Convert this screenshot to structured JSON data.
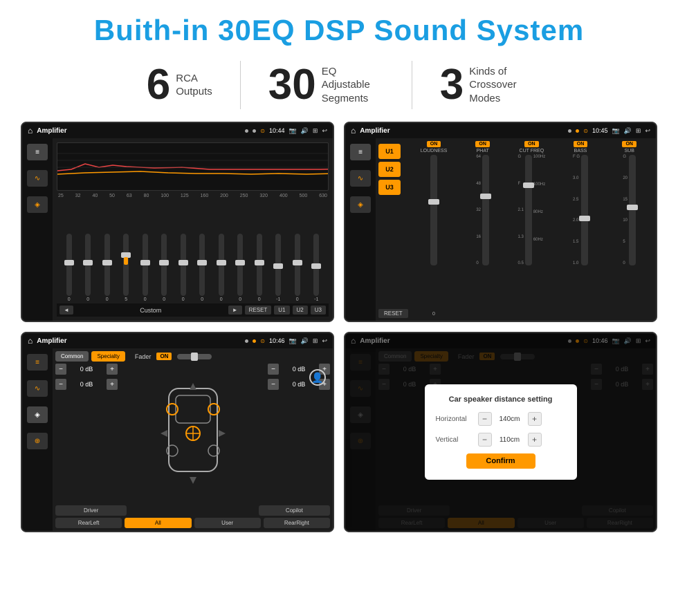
{
  "page": {
    "title": "Buith-in 30EQ DSP Sound System"
  },
  "stats": [
    {
      "number": "6",
      "label_line1": "RCA",
      "label_line2": "Outputs"
    },
    {
      "number": "30",
      "label_line1": "EQ Adjustable",
      "label_line2": "Segments"
    },
    {
      "number": "3",
      "label_line1": "Kinds of",
      "label_line2": "Crossover Modes"
    }
  ],
  "screen1": {
    "title": "Amplifier",
    "time": "10:44",
    "freq_labels": [
      "25",
      "32",
      "40",
      "50",
      "63",
      "80",
      "100",
      "125",
      "160",
      "200",
      "250",
      "320",
      "400",
      "500",
      "630"
    ],
    "eq_values": [
      "0",
      "0",
      "0",
      "5",
      "0",
      "0",
      "0",
      "0",
      "0",
      "0",
      "0",
      "-1",
      "0",
      "-1"
    ],
    "bottom_btns": [
      "◄",
      "Custom",
      "►",
      "RESET",
      "U1",
      "U2",
      "U3"
    ]
  },
  "screen2": {
    "title": "Amplifier",
    "time": "10:45",
    "presets": [
      "U1",
      "U2",
      "U3"
    ],
    "groups": [
      {
        "toggle": "ON",
        "label": "LOUDNESS"
      },
      {
        "toggle": "ON",
        "label": "PHAT"
      },
      {
        "toggle": "ON",
        "label": "CUT FREQ"
      },
      {
        "toggle": "ON",
        "label": "BASS"
      },
      {
        "toggle": "ON",
        "label": "SUB"
      }
    ],
    "reset_label": "RESET"
  },
  "screen3": {
    "title": "Amplifier",
    "time": "10:46",
    "modes": [
      "Common",
      "Specialty"
    ],
    "fader_label": "Fader",
    "fader_toggle": "ON",
    "vol_values": [
      "0 dB",
      "0 dB",
      "0 dB",
      "0 dB"
    ],
    "zone_btns": [
      "Driver",
      "Copilot",
      "RearLeft",
      "All",
      "User",
      "RearRight"
    ]
  },
  "screen4": {
    "title": "Amplifier",
    "time": "10:46",
    "modes": [
      "Common",
      "Specialty"
    ],
    "dialog": {
      "title": "Car speaker distance setting",
      "horizontal_label": "Horizontal",
      "horizontal_value": "140cm",
      "vertical_label": "Vertical",
      "vertical_value": "110cm",
      "confirm_label": "Confirm"
    },
    "zone_btns": [
      "Driver",
      "Copilot",
      "RearLeft",
      "All",
      "User",
      "RearRight"
    ],
    "vol_right_1": "0 dB",
    "vol_right_2": "0 dB"
  }
}
